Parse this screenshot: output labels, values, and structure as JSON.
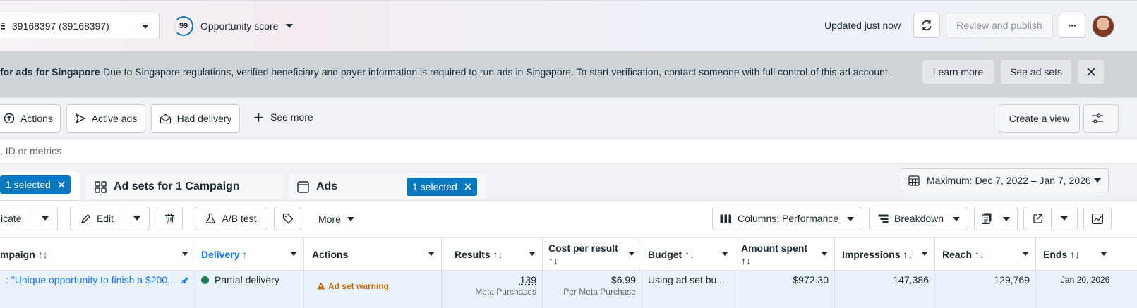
{
  "topbar": {
    "account_label": "39168397 (39168397)",
    "score_value": "99",
    "score_label": "Opportunity score",
    "updated_text": "Updated just now",
    "review_label": "Review and publish",
    "more_glyph": "···"
  },
  "banner": {
    "title": "for ads for Singapore",
    "message": "Due to Singapore regulations, verified beneficiary and payer information is required to run ads in Singapore. To start verification, contact someone with full control of this ad account.",
    "learn_more": "Learn more",
    "see_ad_sets": "See ad sets"
  },
  "filters": {
    "actions": "Actions",
    "active_ads": "Active ads",
    "had_delivery": "Had delivery",
    "see_more": "See more",
    "create_view": "Create a view"
  },
  "search": {
    "placeholder": ", ID or metrics"
  },
  "tabs": {
    "campaigns_selected": "1 selected",
    "ad_sets_label": "Ad sets for 1 Campaign",
    "ads_label": "Ads",
    "ads_selected": "1 selected",
    "date_range": "Maximum: Dec 7, 2022 – Jan 7, 2026"
  },
  "toolbar": {
    "duplicate": "icate",
    "edit": "Edit",
    "ab_test": "A/B test",
    "more": "More",
    "columns": "Columns: Performance",
    "breakdown": "Breakdown"
  },
  "table": {
    "headers": {
      "campaign": "mpaign ↑↓",
      "delivery": "Delivery ↑",
      "actions": "Actions",
      "results": "Results ↑↓",
      "cost_per_result": "Cost per result",
      "cost_sort": "↑↓",
      "budget": "Budget ↑↓",
      "amount_spent": "Amount spent",
      "amount_sort": "↑↓",
      "impressions": "Impressions ↑↓",
      "reach": "Reach ↑↓",
      "ends": "Ends ↑↓"
    },
    "row": {
      "campaign_name": ": \"Unique opportunity to finish a $200,...",
      "delivery": "Partial delivery",
      "warning": "Ad set warning",
      "results": "139",
      "results_sub": "Meta Purchases",
      "cost": "$6.99",
      "cost_sub": "Per Meta Purchase",
      "budget": "Using ad set bu...",
      "amount_spent": "$972.30",
      "impressions": "147,386",
      "reach": "129,769",
      "ends": "Jan 20, 2026"
    }
  },
  "colors": {
    "accent": "#0a78be",
    "link": "#1877f2",
    "delivery_dot": "#1e7b57",
    "warning": "#c46a00"
  }
}
